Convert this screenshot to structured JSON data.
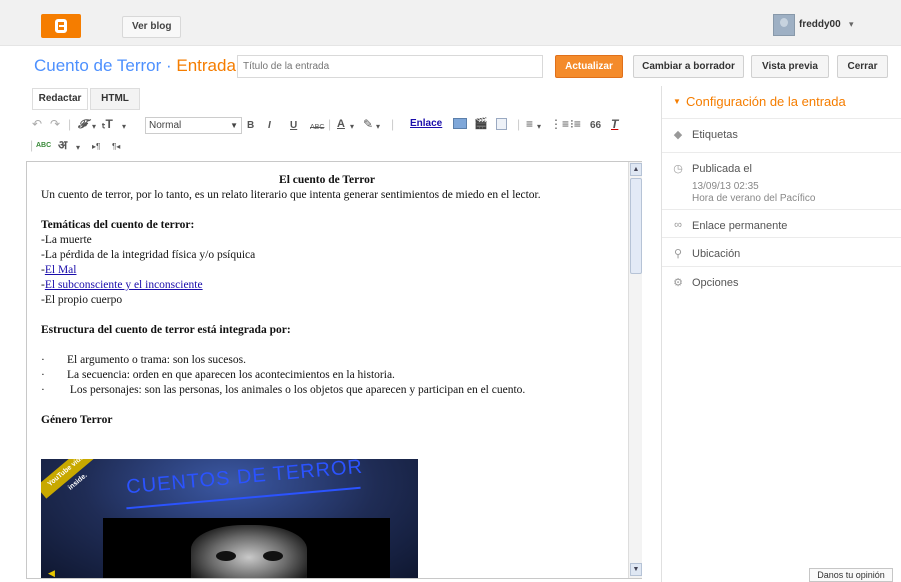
{
  "topbar": {
    "view_blog": "Ver blog",
    "username": "freddy00",
    "logo_icon": "blogger-logo-icon",
    "user_caret": "▾"
  },
  "header": {
    "blog_name": "Cuento de Terror",
    "separator": " · ",
    "post_label": "Entrada",
    "title_placeholder": "Título de la entrada",
    "buttons": {
      "update": "Actualizar",
      "draft": "Cambiar a borrador",
      "preview": "Vista previa",
      "close": "Cerrar"
    }
  },
  "editor": {
    "tabs": {
      "compose": "Redactar",
      "html": "HTML"
    },
    "toolbar": {
      "format_value": "Normal",
      "link": "Enlace",
      "bold": "B",
      "italic": "I",
      "underline": "U",
      "strike": "ABC",
      "font": "𝓕",
      "font_size": "ₜT",
      "text_color": "A",
      "quote": "66",
      "clear_format": "T",
      "spell": "ABC",
      "translit": "अ",
      "ltr": "▸¶",
      "rtl": "¶◂"
    },
    "content": {
      "title": "El cuento de Terror",
      "intro": "Un cuento de terror, por lo tanto, es un relato literario que intenta generar sentimientos de miedo en el lector.",
      "themes_heading": "Temáticas del cuento de terror:",
      "themes": [
        {
          "text": "-La muerte",
          "link": false
        },
        {
          "text": "-La pérdida de la integridad física y/o psíquica",
          "link": false
        },
        {
          "text": "-",
          "linktext": "El Mal",
          "link": true
        },
        {
          "text": "-",
          "linktext": "El subconsciente y el inconsciente ",
          "link": true
        },
        {
          "text": "-El propio cuerpo",
          "link": false
        }
      ],
      "structure_heading": "Estructura del cuento de terror está integrada por:",
      "structure": [
        "El argumento o trama: son los sucesos.",
        "La secuencia: orden en que aparecen los acontecimientos en la historia.",
        " Los personajes: son las personas, los animales o los objetos que aparecen y participan en el cuento."
      ],
      "bullet_char": "·",
      "genre_heading": "Género Terror",
      "video": {
        "title": "CUENTOS DE TERROR",
        "badge": "YouTube video inside."
      }
    }
  },
  "sidebar": {
    "header": "Configuración de la entrada",
    "labels": "Etiquetas",
    "published": "Publicada el",
    "published_date": "13/09/13 02:35",
    "published_tz": "Hora de verano del Pacífico",
    "permalink": "Enlace permanente",
    "location": "Ubicación",
    "options": "Opciones"
  },
  "feedback": "Danos tu opinión",
  "colors": {
    "accent_orange": "#f57d00",
    "link_blue": "#4d90fe",
    "update_button": "#f48b2b"
  }
}
